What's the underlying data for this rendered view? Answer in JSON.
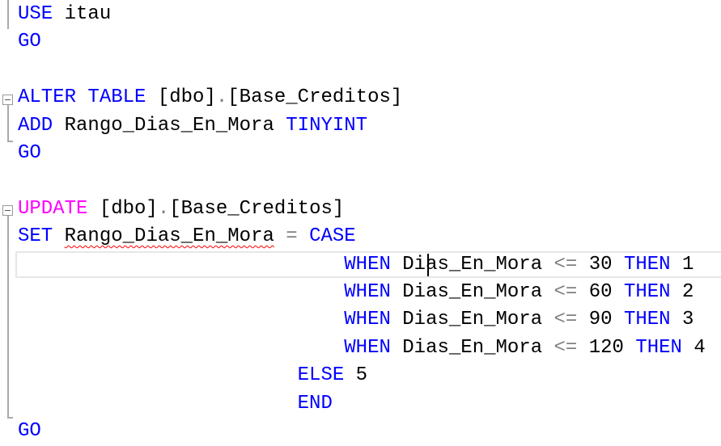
{
  "editor": {
    "lines": [
      [
        {
          "t": "USE",
          "c": "kw"
        },
        {
          "t": " itau",
          "c": "tx"
        }
      ],
      [
        {
          "t": "GO",
          "c": "kw"
        }
      ],
      [],
      [
        {
          "t": "ALTER TABLE",
          "c": "kw"
        },
        {
          "t": " [dbo]",
          "c": "tx"
        },
        {
          "t": ".",
          "c": "op"
        },
        {
          "t": "[Base_Creditos]",
          "c": "tx"
        }
      ],
      [
        {
          "t": "ADD",
          "c": "kw"
        },
        {
          "t": " Rango_Dias_En_Mora ",
          "c": "tx"
        },
        {
          "t": "TINYINT",
          "c": "kw"
        }
      ],
      [
        {
          "t": "GO",
          "c": "kw"
        }
      ],
      [],
      [
        {
          "t": "UPDATE",
          "c": "fn"
        },
        {
          "t": " [dbo]",
          "c": "tx"
        },
        {
          "t": ".",
          "c": "op"
        },
        {
          "t": "[Base_Creditos]",
          "c": "tx"
        }
      ],
      [
        {
          "t": "SET",
          "c": "kw"
        },
        {
          "t": " ",
          "c": "tx"
        },
        {
          "t": "Rango_Dias_En_Mora",
          "c": "tx sq"
        },
        {
          "t": " ",
          "c": "tx"
        },
        {
          "t": "=",
          "c": "op"
        },
        {
          "t": " ",
          "c": "tx"
        },
        {
          "t": "CASE",
          "c": "kw"
        }
      ],
      [
        {
          "t": "                            ",
          "c": "tx"
        },
        {
          "t": "WHEN",
          "c": "kw"
        },
        {
          "t": " Dias_En_Mora ",
          "c": "tx"
        },
        {
          "t": "<=",
          "c": "op"
        },
        {
          "t": " 30 ",
          "c": "tx"
        },
        {
          "t": "THEN",
          "c": "kw"
        },
        {
          "t": " 1",
          "c": "tx"
        }
      ],
      [
        {
          "t": "                            ",
          "c": "tx"
        },
        {
          "t": "WHEN",
          "c": "kw"
        },
        {
          "t": " Dias_En_Mora ",
          "c": "tx"
        },
        {
          "t": "<=",
          "c": "op"
        },
        {
          "t": " 60 ",
          "c": "tx"
        },
        {
          "t": "THEN",
          "c": "kw"
        },
        {
          "t": " 2",
          "c": "tx"
        }
      ],
      [
        {
          "t": "                            ",
          "c": "tx"
        },
        {
          "t": "WHEN",
          "c": "kw"
        },
        {
          "t": " Dias_En_Mora ",
          "c": "tx"
        },
        {
          "t": "<=",
          "c": "op"
        },
        {
          "t": " 90 ",
          "c": "tx"
        },
        {
          "t": "THEN",
          "c": "kw"
        },
        {
          "t": " 3",
          "c": "tx"
        }
      ],
      [
        {
          "t": "                            ",
          "c": "tx"
        },
        {
          "t": "WHEN",
          "c": "kw"
        },
        {
          "t": " Dias_En_Mora ",
          "c": "tx"
        },
        {
          "t": "<=",
          "c": "op"
        },
        {
          "t": " 120 ",
          "c": "tx"
        },
        {
          "t": "THEN",
          "c": "kw"
        },
        {
          "t": " 4",
          "c": "tx"
        }
      ],
      [
        {
          "t": "                        ",
          "c": "tx"
        },
        {
          "t": "ELSE",
          "c": "kw"
        },
        {
          "t": " 5",
          "c": "tx"
        }
      ],
      [
        {
          "t": "                        ",
          "c": "tx"
        },
        {
          "t": "END",
          "c": "kw"
        }
      ],
      [
        {
          "t": "GO",
          "c": "kw"
        }
      ]
    ]
  }
}
